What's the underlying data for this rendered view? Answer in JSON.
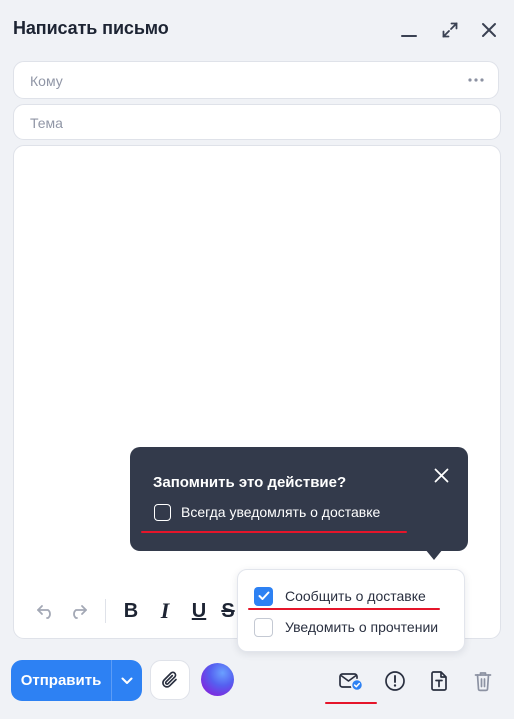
{
  "window": {
    "title": "Написать письмо",
    "minimize_icon": "minimize-icon",
    "expand_icon": "expand-icon",
    "close_icon": "close-icon"
  },
  "fields": {
    "to_placeholder": "Кому",
    "subject_placeholder": "Тема",
    "more_icon": "more-dots-icon"
  },
  "toolbar": {
    "undo_icon": "undo-icon",
    "redo_icon": "redo-icon",
    "bold": "B",
    "italic": "I",
    "underline": "U",
    "strike": "S"
  },
  "popover": {
    "title": "Запомнить это действие?",
    "checkbox_label": "Всегда уведомлять о доставке",
    "checked": false
  },
  "menu": {
    "items": [
      {
        "label": "Сообщить о доставке",
        "checked": true
      },
      {
        "label": "Уведомить о прочтении",
        "checked": false
      }
    ]
  },
  "bottom": {
    "send_label": "Отправить",
    "attach_icon": "paperclip-icon",
    "assistant_icon": "ai-orb-icon",
    "notify_icon": "envelope-check-icon",
    "priority_icon": "exclamation-circle-icon",
    "template_icon": "text-template-icon",
    "delete_icon": "trash-icon"
  },
  "colors": {
    "accent": "#2d81f3",
    "popover_bg": "#333a4b",
    "highlight": "#e5152a"
  }
}
